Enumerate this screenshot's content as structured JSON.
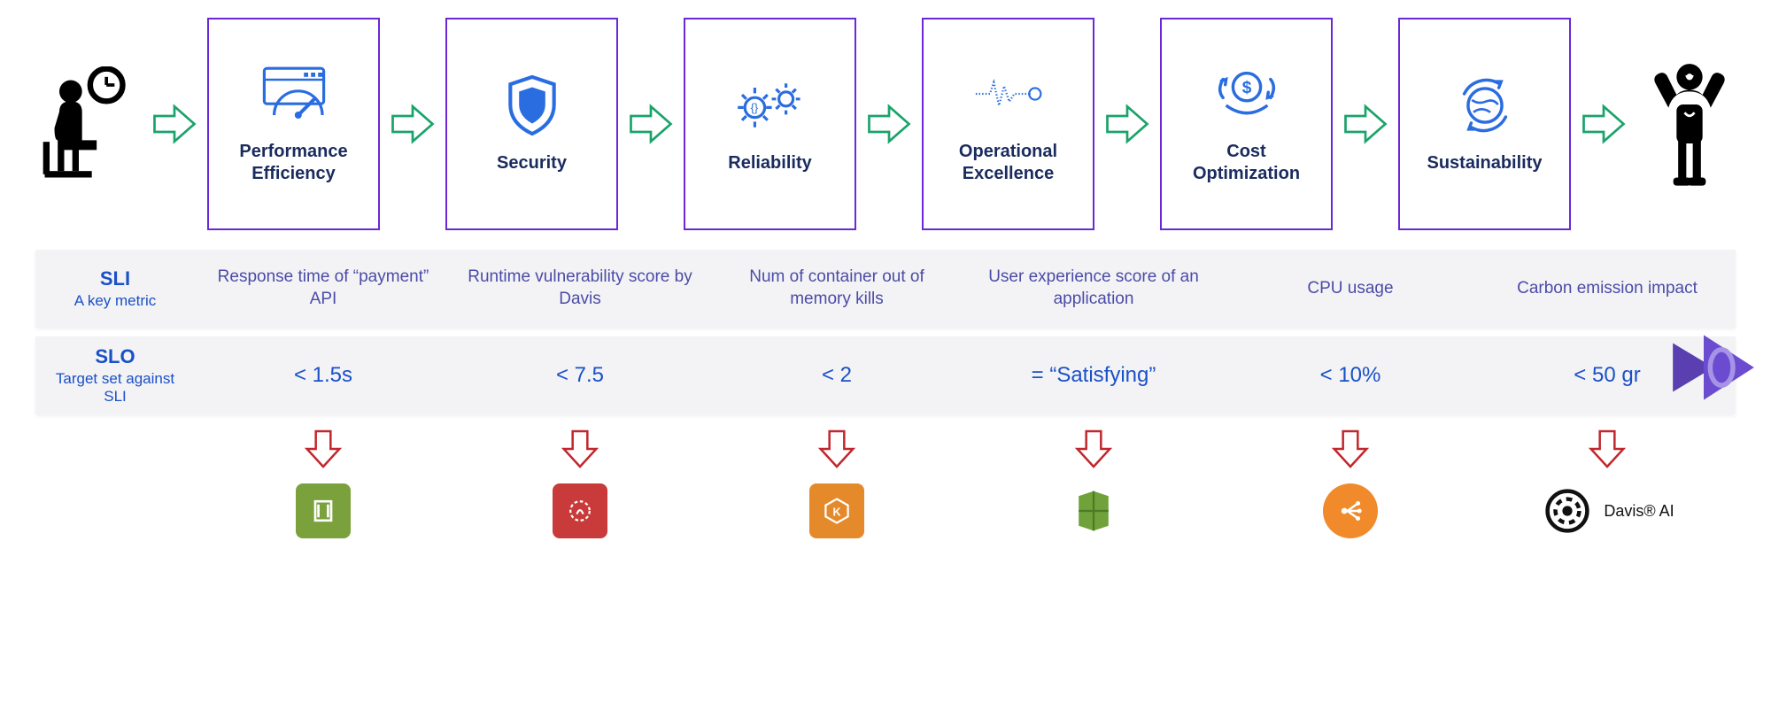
{
  "pillars": [
    {
      "label": "Performance\nEfficiency",
      "icon": "speedometer"
    },
    {
      "label": "Security",
      "icon": "shield"
    },
    {
      "label": "Reliability",
      "icon": "gears"
    },
    {
      "label": "Operational\nExcellence",
      "icon": "waveform"
    },
    {
      "label": "Cost\nOptimization",
      "icon": "dollar-cycle"
    },
    {
      "label": "Sustainability",
      "icon": "globe-cycle"
    }
  ],
  "sli": {
    "header_name": "SLI",
    "header_sub": "A key metric",
    "values": [
      "Response time of “payment” API",
      "Runtime vulnerability score by Davis",
      "Num of container out of memory kills",
      "User experience score of an application",
      "CPU usage",
      "Carbon emission impact"
    ]
  },
  "slo": {
    "header_name": "SLO",
    "header_sub": "Target set against SLI",
    "values": [
      "< 1.5s",
      "< 7.5",
      "< 2",
      "= “Satisfying”",
      "< 10%",
      "< 50 gr"
    ]
  },
  "vendors": [
    {
      "color": "#7aa13c",
      "shortcolor": "#7aa13c"
    },
    {
      "color": "#c93a3a"
    },
    {
      "color": "#e58a2a"
    },
    {
      "color": "#6fa23a"
    },
    {
      "color": "#f08a2a"
    },
    {
      "color": "#111111",
      "label": "Davis® AI"
    }
  ]
}
